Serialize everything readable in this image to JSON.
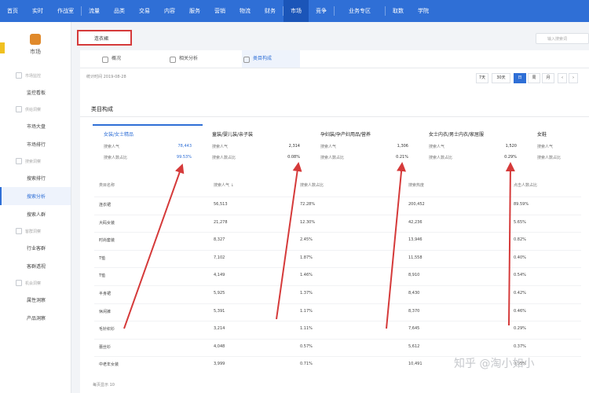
{
  "topnav": {
    "items": [
      "首页",
      "实时",
      "作战室",
      "流量",
      "品类",
      "交易",
      "内容",
      "服务",
      "营销",
      "物流",
      "财务",
      "市场",
      "竞争",
      "业务专区",
      "取数",
      "学院"
    ],
    "active": "市场",
    "accent": "#2f6fd6"
  },
  "sidebar": {
    "title": "市场",
    "groups": [
      {
        "label": "市场监控",
        "items": [
          "监控看板"
        ]
      },
      {
        "label": "供给洞察",
        "items": [
          "市场大盘",
          "市场排行"
        ]
      },
      {
        "label": "搜索洞察",
        "items": [
          "搜索排行",
          "搜索分析",
          "搜索人群"
        ]
      },
      {
        "label": "客群洞察",
        "items": [
          "行业客群",
          "客群透视"
        ]
      },
      {
        "label": "机会洞察",
        "items": [
          "属性洞察",
          "产品洞察"
        ]
      }
    ],
    "active_item": "搜索分析"
  },
  "header": {
    "chip": "连衣裙",
    "search_placeholder": "输入搜索词"
  },
  "tabs": [
    "概况",
    "相关分析",
    "类目构成"
  ],
  "active_tab": "类目构成",
  "meta": "统计时间 2019-08-28",
  "periods": [
    "7天",
    "30天",
    "日",
    "周",
    "月"
  ],
  "active_period": "日",
  "section_title": "类目构成",
  "categories": [
    {
      "name": "女装/女士精品",
      "label1": "搜索人气",
      "v1": "78,443",
      "label2": "搜索人数占比",
      "v2": "99.53%"
    },
    {
      "name": "童装/婴儿装/亲子装",
      "label1": "搜索人气",
      "v1": "2,314",
      "label2": "搜索人数占比",
      "v2": "0.08%"
    },
    {
      "name": "孕妇装/孕产妇用品/营养",
      "label1": "搜索人气",
      "v1": "1,306",
      "label2": "搜索人数占比",
      "v2": "0.21%"
    },
    {
      "name": "女士内衣/男士内衣/家居服",
      "label1": "搜索人气",
      "v1": "1,520",
      "label2": "搜索人数占比",
      "v2": "0.29%"
    },
    {
      "name": "女鞋",
      "label1": "搜索人气",
      "v1": "",
      "label2": "搜索人数占比",
      "v2": ""
    }
  ],
  "table": {
    "headers": [
      "类目名称",
      "搜索人气 ↓",
      "搜索人数占比",
      "搜索热度",
      "点击人数占比"
    ],
    "rows": [
      [
        "连衣裙",
        "56,513",
        "72.28%",
        "200,452",
        "89.59%"
      ],
      [
        "大码女装",
        "21,278",
        "12.30%",
        "42,236",
        "5.65%"
      ],
      [
        "时尚套装",
        "8,327",
        "2.45%",
        "13,946",
        "0.82%"
      ],
      [
        "T恤",
        "7,102",
        "1.87%",
        "11,558",
        "0.40%"
      ],
      [
        "T恤",
        "4,149",
        "1.46%",
        "8,910",
        "0.54%"
      ],
      [
        "半身裙",
        "5,925",
        "1.37%",
        "8,430",
        "0.42%"
      ],
      [
        "休闲裤",
        "5,391",
        "1.17%",
        "8,370",
        "0.46%"
      ],
      [
        "毛针织衫",
        "3,214",
        "1.11%",
        "7,645",
        "0.29%"
      ],
      [
        "蕾丝衫",
        "4,048",
        "0.57%",
        "5,612",
        "0.37%"
      ],
      [
        "中老年女装",
        "3,999",
        "0.71%",
        "10,491",
        "0.35%"
      ]
    ]
  },
  "footer": "每页显示 10",
  "watermark": "知乎 @淘小如小",
  "annotation_color": "#d53a3a"
}
